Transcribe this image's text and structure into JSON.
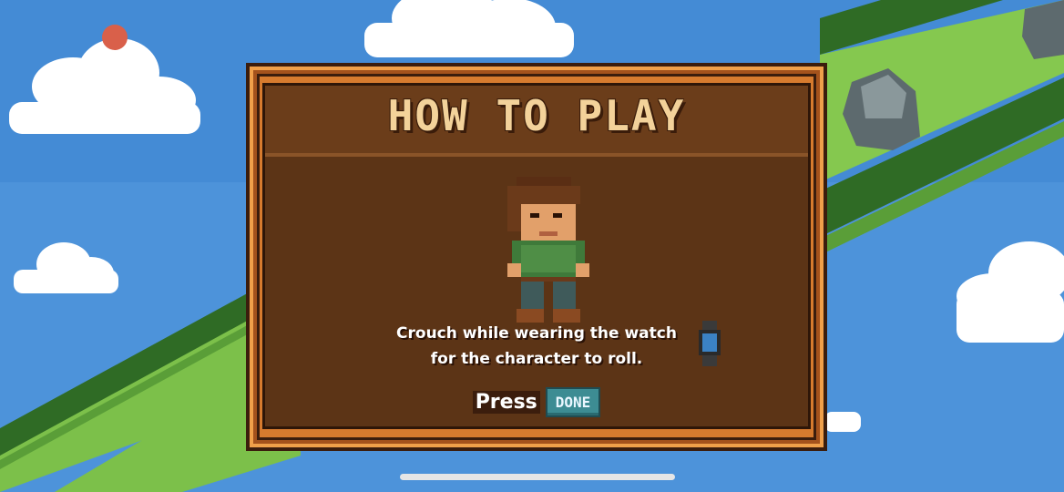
{
  "dialog": {
    "title": "HOW TO PLAY",
    "instruction_line1": "Crouch while wearing the watch",
    "instruction_line2": "for the character to roll.",
    "press_label": "Press",
    "done_label": "DONE"
  },
  "icons": {
    "character": "pixel-hero-sprite",
    "watch": "smartwatch-icon"
  },
  "colors": {
    "sky": "#4a8fd6",
    "grass": "#7fc24a",
    "panel_frame": "#d77b2e",
    "panel_wood": "#5c3416",
    "title_text": "#f3d29a",
    "done_button": "#3d8c93",
    "record_dot": "#d9604a"
  }
}
